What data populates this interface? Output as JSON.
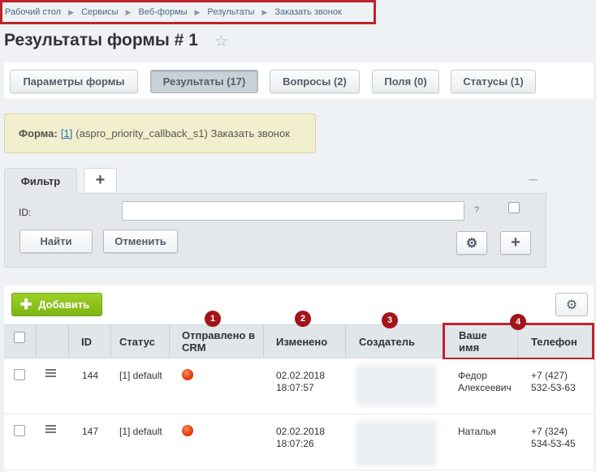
{
  "breadcrumb": {
    "items": [
      "Рабочий стол",
      "Сервисы",
      "Веб-формы",
      "Результаты",
      "Заказать звонок"
    ]
  },
  "page": {
    "title": "Результаты формы # 1"
  },
  "tabs": [
    {
      "label": "Параметры формы"
    },
    {
      "label": "Результаты (17)"
    },
    {
      "label": "Вопросы (2)"
    },
    {
      "label": "Поля (0)"
    },
    {
      "label": "Статусы (1)"
    }
  ],
  "form_info": {
    "label": "Форма:",
    "link": "[1]",
    "text": "(aspro_priority_callback_s1) Заказать звонок"
  },
  "filter": {
    "tab_label": "Фильтр",
    "add_tab": "+",
    "collapse": "–",
    "id_label": "ID:",
    "id_value": "",
    "help": "?",
    "find_button": "Найти",
    "cancel_button": "Отменить",
    "plus_button": "+"
  },
  "list": {
    "add_button": "Добавить",
    "columns": [
      "ID",
      "Статус",
      "Отправлено в CRM",
      "Изменено",
      "Создатель",
      "Ваше имя",
      "Телефон"
    ],
    "badges": [
      "1",
      "2",
      "3",
      "4"
    ],
    "rows": [
      {
        "id": "144",
        "status": "[1] default",
        "crm": "red-dot-icon",
        "changed_date": "02.02.2018",
        "changed_time": "18:07:57",
        "name_line1": "Федор",
        "name_line2": "Алексеевич",
        "phone_line1": "+7 (427)",
        "phone_line2": "532-53-63"
      },
      {
        "id": "147",
        "status": "[1] default",
        "crm": "red-dot-icon",
        "changed_date": "02.02.2018",
        "changed_time": "18:07:26",
        "name_line1": "Наталья",
        "name_line2": "",
        "phone_line1": "+7 (324)",
        "phone_line2": "534-53-45"
      }
    ]
  },
  "colors": {
    "highlight": "#c0232a",
    "badge": "#a3141a",
    "add_button": "#8cc21d",
    "crm_dot": "#e43a10"
  }
}
